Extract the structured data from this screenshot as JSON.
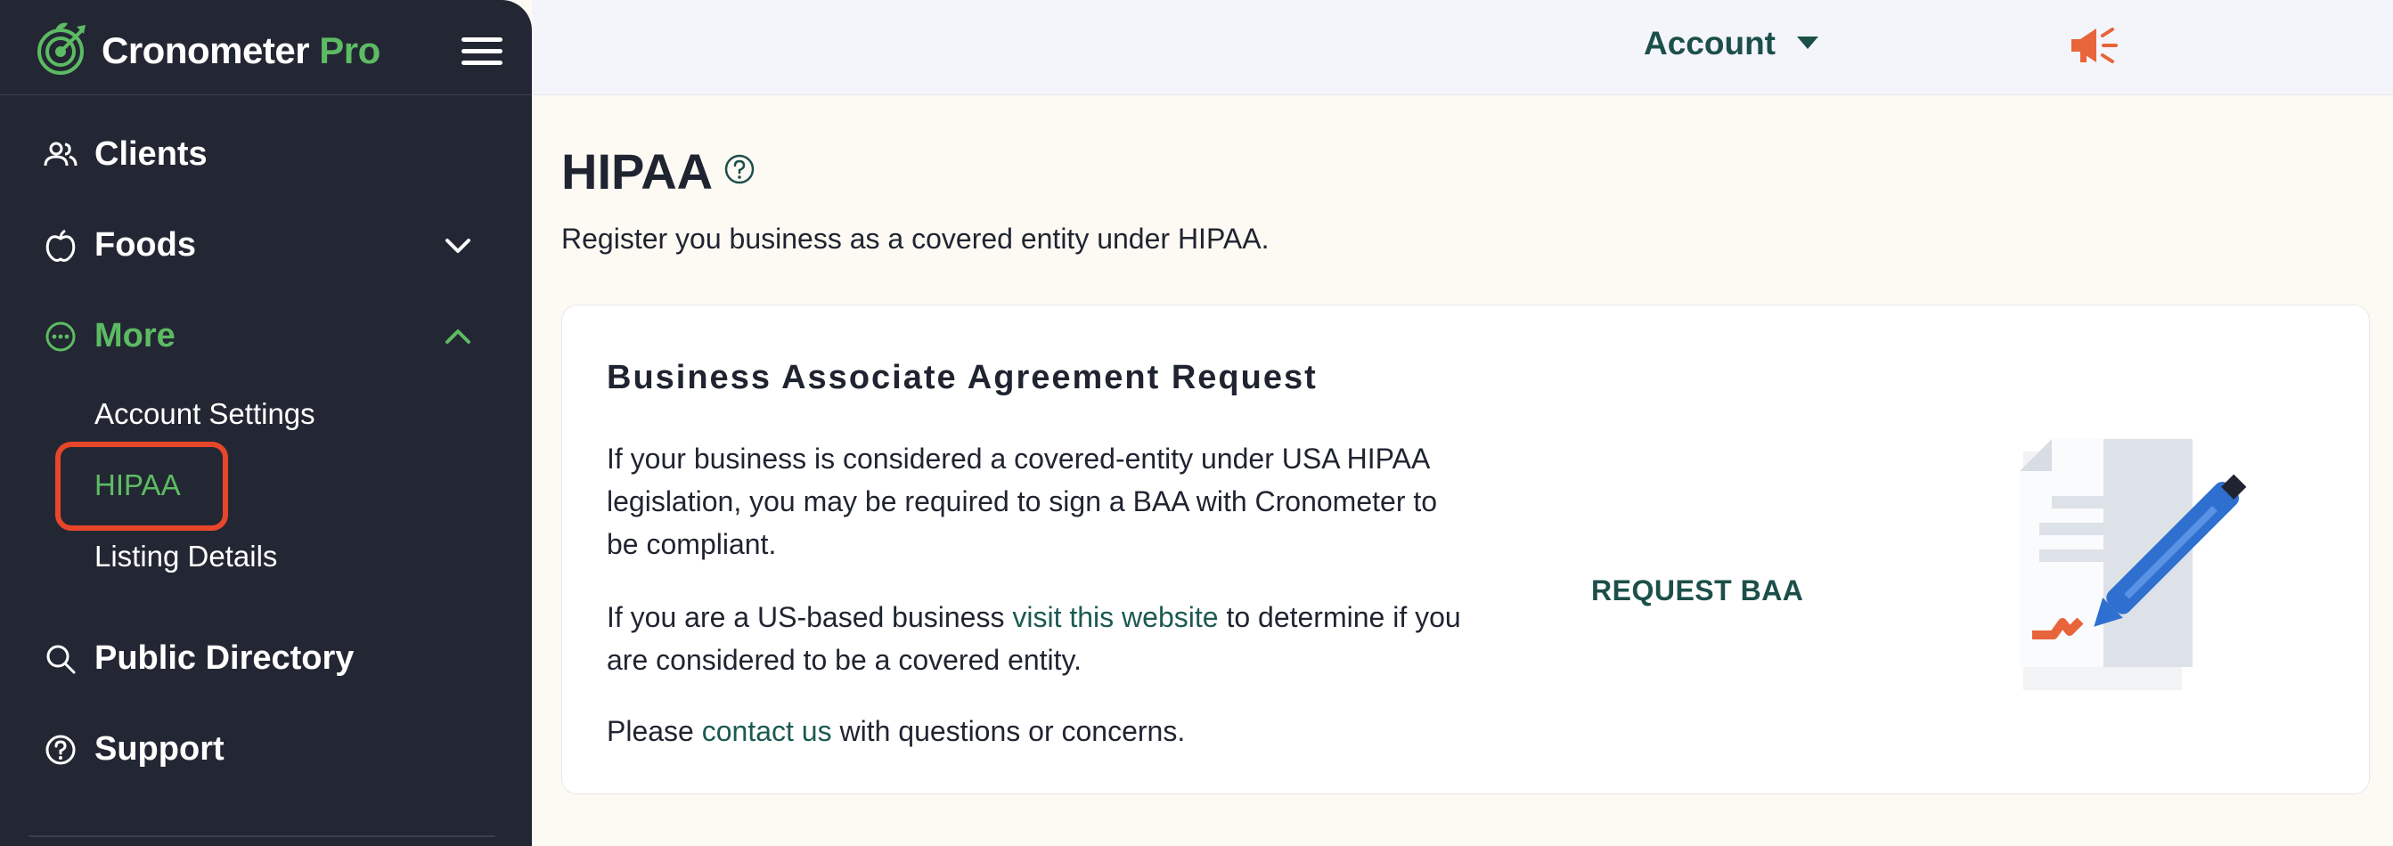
{
  "brand": {
    "name": "Cronometer",
    "suffix": "Pro"
  },
  "sidebar": {
    "items": [
      {
        "label": "Clients",
        "icon": "users-icon"
      },
      {
        "label": "Foods",
        "icon": "apple-icon",
        "chevron": "chevron-down-icon"
      },
      {
        "label": "More",
        "icon": "more-icon",
        "chevron": "chevron-up-icon"
      },
      {
        "label": "Public Directory",
        "icon": "search-icon"
      },
      {
        "label": "Support",
        "icon": "help-circle-icon"
      }
    ],
    "sub_items": [
      {
        "label": "Account Settings"
      },
      {
        "label": "HIPAA"
      },
      {
        "label": "Listing Details"
      }
    ]
  },
  "topbar": {
    "account_label": "Account",
    "megaphone_icon": "megaphone-icon"
  },
  "main": {
    "title": "HIPAA",
    "subtitle": "Register you business as a covered entity under HIPAA."
  },
  "card": {
    "title": "Business Associate Agreement Request",
    "para1": "If your business is considered a covered-entity under USA HIPAA legislation, you may be required to sign a BAA with Cronometer to be compliant.",
    "para2_before": "If you are a US-based business ",
    "para2_link": "visit this website",
    "para2_after": " to determine if you are considered to be a covered entity.",
    "para3_before": "Please ",
    "para3_link": "contact us",
    "para3_after": " with questions or concerns.",
    "button_label": "REQUEST BAA"
  },
  "colors": {
    "sidebar_bg": "#232733",
    "accent_green": "#5dbb63",
    "link_teal": "#1c5a52",
    "highlight": "#e8462a",
    "megaphone": "#e8643a"
  }
}
